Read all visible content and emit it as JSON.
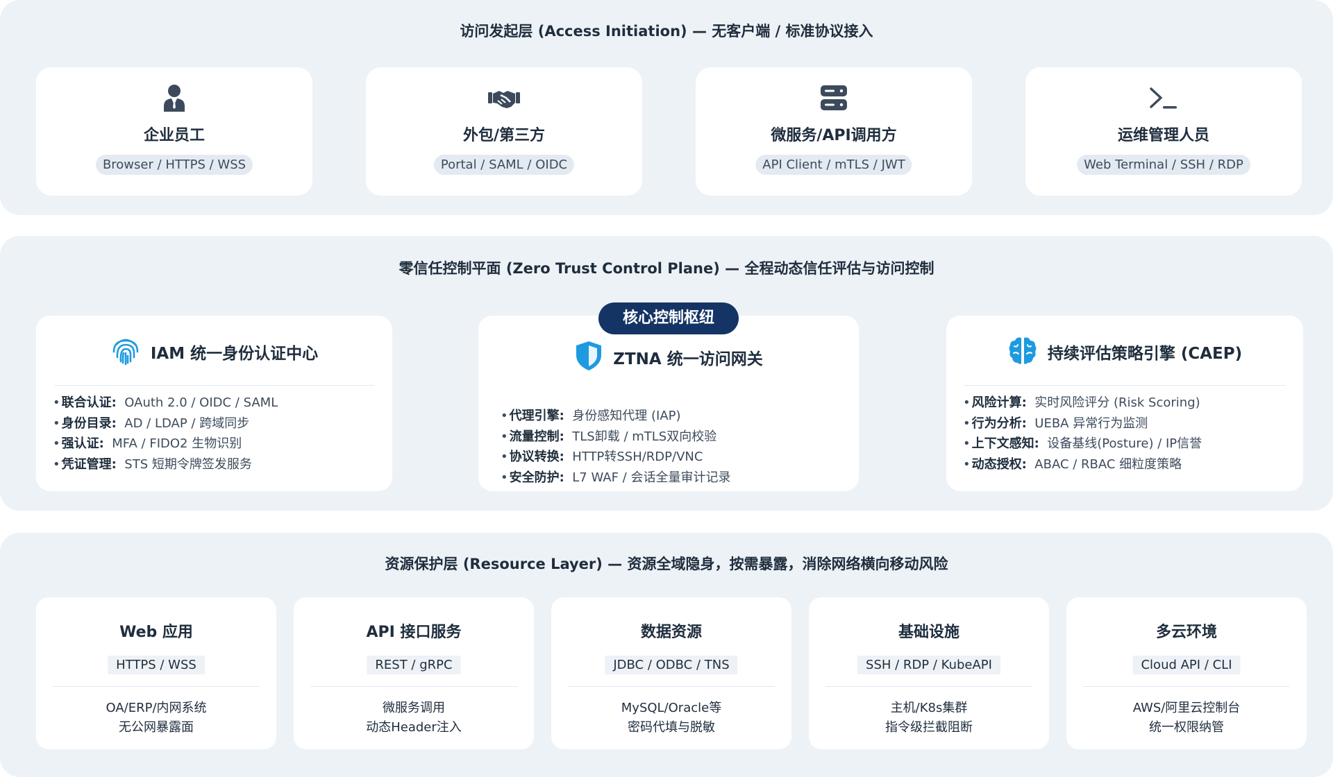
{
  "access_layer": {
    "title": "访问发起层 (Access Initiation) — 无客户端 / 标准协议接入",
    "cards": [
      {
        "icon": "employee-icon",
        "title": "企业员工",
        "tag": "Browser / HTTPS / WSS"
      },
      {
        "icon": "handshake-icon",
        "title": "外包/第三方",
        "tag": "Portal / SAML / OIDC"
      },
      {
        "icon": "server-icon",
        "title": "微服务/API调用方",
        "tag": "API Client / mTLS / JWT"
      },
      {
        "icon": "terminal-icon",
        "title": "运维管理人员",
        "tag": "Web Terminal / SSH / RDP"
      }
    ]
  },
  "control_layer": {
    "title": "零信任控制平面 (Zero Trust Control Plane) — 全程动态信任评估与访问控制",
    "hub_badge": "核心控制枢纽",
    "cards": [
      {
        "icon": "fingerprint-icon",
        "title": "IAM 统一身份认证中心",
        "items": [
          {
            "key": "联合认证:",
            "value": "OAuth 2.0 / OIDC / SAML"
          },
          {
            "key": "身份目录:",
            "value": "AD / LDAP / 跨域同步"
          },
          {
            "key": "强认证:",
            "value": "MFA / FIDO2 生物识别"
          },
          {
            "key": "凭证管理:",
            "value": "STS 短期令牌签发服务"
          }
        ]
      },
      {
        "icon": "shield-icon",
        "title": "ZTNA 统一访问网关",
        "items": [
          {
            "key": "代理引擎:",
            "value": "身份感知代理 (IAP)"
          },
          {
            "key": "流量控制:",
            "value": "TLS卸载 / mTLS双向校验"
          },
          {
            "key": "协议转换:",
            "value": "HTTP转SSH/RDP/VNC"
          },
          {
            "key": "安全防护:",
            "value": "L7 WAF / 会话全量审计记录"
          }
        ]
      },
      {
        "icon": "brain-icon",
        "title": "持续评估策略引擎 (CAEP)",
        "items": [
          {
            "key": "风险计算:",
            "value": "实时风险评分 (Risk Scoring)"
          },
          {
            "key": "行为分析:",
            "value": "UEBA 异常行为监测"
          },
          {
            "key": "上下文感知:",
            "value": "设备基线(Posture) / IP信誉"
          },
          {
            "key": "动态授权:",
            "value": "ABAC / RBAC 细粒度策略"
          }
        ]
      }
    ]
  },
  "resource_layer": {
    "title": "资源保护层 (Resource Layer) — 资源全域隐身，按需暴露，消除网络横向移动风险",
    "cards": [
      {
        "title": "Web 应用",
        "tag": "HTTPS / WSS",
        "line1": "OA/ERP/内网系统",
        "line2": "无公网暴露面"
      },
      {
        "title": "API 接口服务",
        "tag": "REST / gRPC",
        "line1": "微服务调用",
        "line2": "动态Header注入"
      },
      {
        "title": "数据资源",
        "tag": "JDBC / ODBC / TNS",
        "line1": "MySQL/Oracle等",
        "line2": "密码代填与脱敏"
      },
      {
        "title": "基础设施",
        "tag": "SSH / RDP / KubeAPI",
        "line1": "主机/K8s集群",
        "line2": "指令级拦截阻断"
      },
      {
        "title": "多云环境",
        "tag": "Cloud API / CLI",
        "line1": "AWS/阿里云控制台",
        "line2": "统一权限纳管"
      }
    ]
  },
  "colors": {
    "layer_bg": "#edf2f7",
    "card_bg": "#ffffff",
    "text_dark": "#1f2d3d",
    "hub_badge_bg": "#143466",
    "icon_blue": "#1e9ae0",
    "icon_gray": "#3c4a5c"
  }
}
